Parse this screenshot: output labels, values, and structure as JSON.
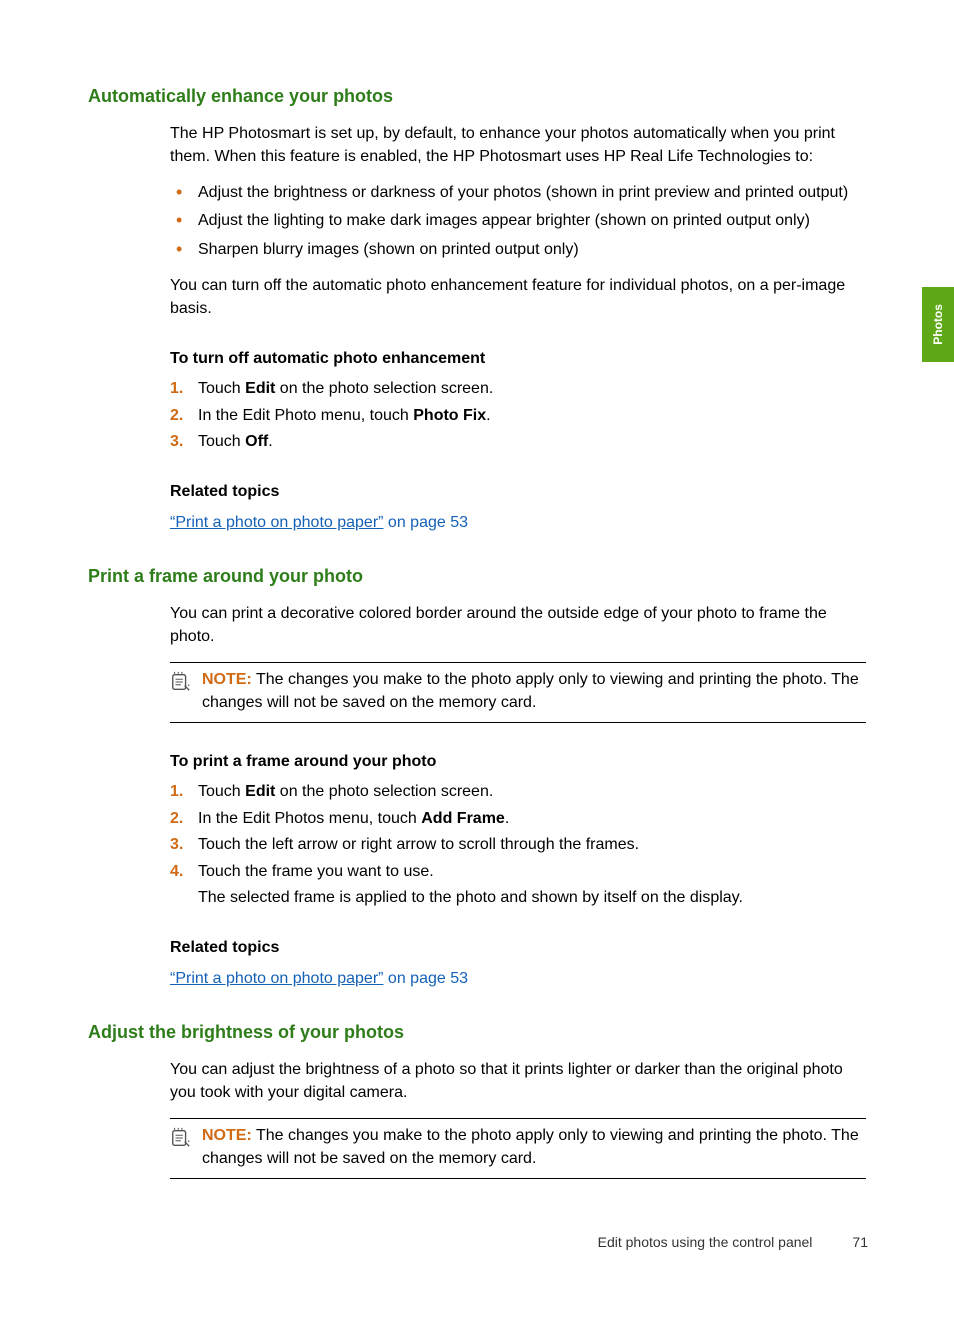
{
  "sideTab": "Photos",
  "sections": {
    "enhance": {
      "title": "Automatically enhance your photos",
      "intro": "The HP Photosmart is set up, by default, to enhance your photos automatically when you print them. When this feature is enabled, the HP Photosmart uses HP Real Life Technologies to:",
      "bullets": [
        "Adjust the brightness or darkness of your photos (shown in print preview and printed output)",
        "Adjust the lighting to make dark images appear brighter (shown on printed output only)",
        "Sharpen blurry images (shown on printed output only)"
      ],
      "afterBullets": "You can turn off the automatic photo enhancement feature for individual photos, on a per-image basis.",
      "procTitle": "To turn off automatic photo enhancement",
      "steps": {
        "s1a": "Touch ",
        "s1b": "Edit",
        "s1c": " on the photo selection screen.",
        "s2a": "In the Edit Photo menu, touch ",
        "s2b": "Photo Fix",
        "s2c": ".",
        "s3a": "Touch ",
        "s3b": "Off",
        "s3c": "."
      },
      "relatedTitle": "Related topics",
      "relatedLink": "“Print a photo on photo paper”",
      "relatedSuffix": " on page 53"
    },
    "frame": {
      "title": "Print a frame around your photo",
      "intro": "You can print a decorative colored border around the outside edge of your photo to frame the photo.",
      "noteLabel": "NOTE:",
      "noteText": " The changes you make to the photo apply only to viewing and printing the photo. The changes will not be saved on the memory card.",
      "procTitle": "To print a frame around your photo",
      "steps": {
        "s1a": "Touch ",
        "s1b": "Edit",
        "s1c": " on the photo selection screen.",
        "s2a": "In the Edit Photos menu, touch ",
        "s2b": "Add Frame",
        "s2c": ".",
        "s3": "Touch the left arrow or right arrow to scroll through the frames.",
        "s4": "Touch the frame you want to use.",
        "s4extra": "The selected frame is applied to the photo and shown by itself on the display."
      },
      "relatedTitle": "Related topics",
      "relatedLink": "“Print a photo on photo paper”",
      "relatedSuffix": " on page 53"
    },
    "brightness": {
      "title": "Adjust the brightness of your photos",
      "intro": "You can adjust the brightness of a photo so that it prints lighter or darker than the original photo you took with your digital camera.",
      "noteLabel": "NOTE:",
      "noteText": " The changes you make to the photo apply only to viewing and printing the photo. The changes will not be saved on the memory card."
    }
  },
  "footer": {
    "text": "Edit photos using the control panel",
    "page": "71"
  }
}
